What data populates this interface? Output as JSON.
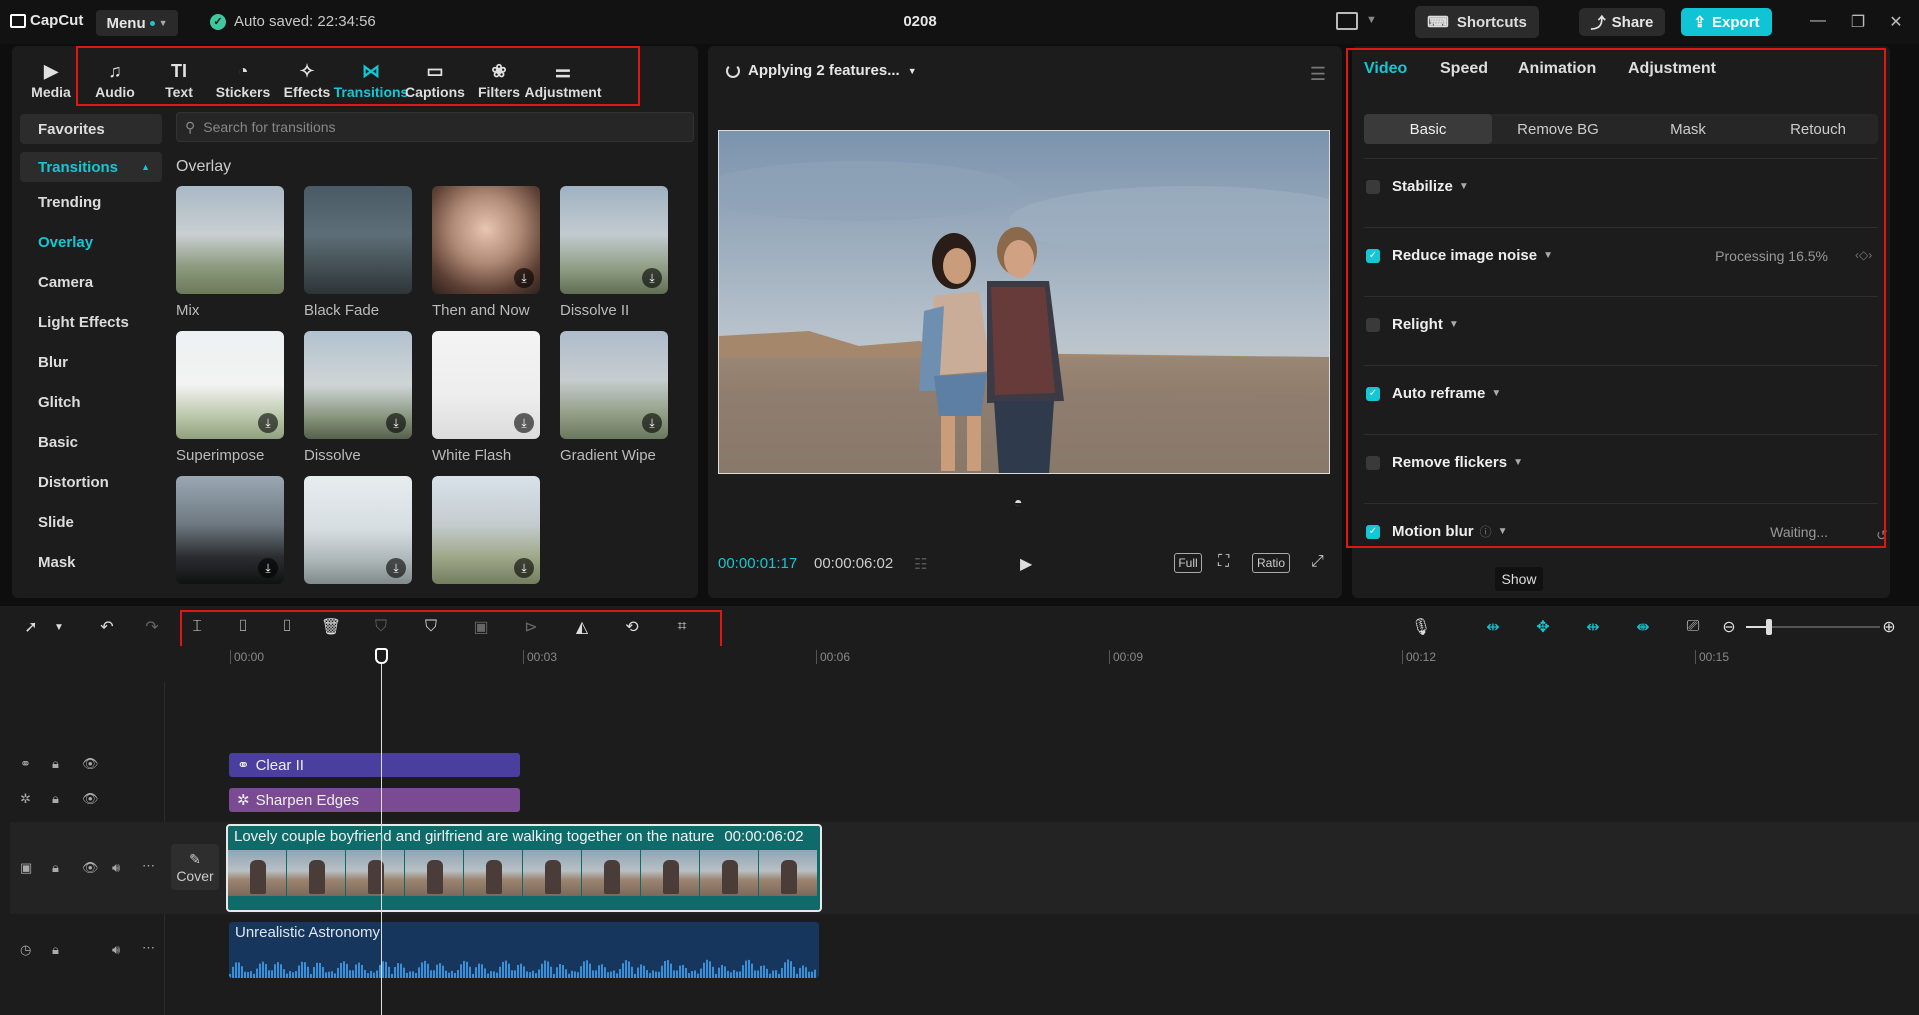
{
  "topbar": {
    "app_name": "CapCut",
    "menu_label": "Menu",
    "autosave": "Auto saved: 22:34:56",
    "project_title": "0208",
    "shortcuts_label": "Shortcuts",
    "share_label": "Share",
    "export_label": "Export"
  },
  "toolbar": [
    {
      "label": "Media",
      "icon": "media-icon",
      "glyph": "▶"
    },
    {
      "label": "Audio",
      "icon": "audio-icon",
      "glyph": "♫"
    },
    {
      "label": "Text",
      "icon": "text-icon",
      "glyph": "TI"
    },
    {
      "label": "Stickers",
      "icon": "stickers-icon",
      "glyph": "◔"
    },
    {
      "label": "Effects",
      "icon": "effects-icon",
      "glyph": "✧"
    },
    {
      "label": "Transitions",
      "icon": "transitions-icon",
      "glyph": "⋈"
    },
    {
      "label": "Captions",
      "icon": "captions-icon",
      "glyph": "▭"
    },
    {
      "label": "Filters",
      "icon": "filters-icon",
      "glyph": "❀"
    },
    {
      "label": "Adjustment",
      "icon": "adjustment-icon",
      "glyph": "⚌"
    }
  ],
  "active_tool": "Transitions",
  "sidebar": {
    "favorites": "Favorites",
    "category": "Transitions",
    "items": [
      "Trending",
      "Overlay",
      "Camera",
      "Light Effects",
      "Blur",
      "Glitch",
      "Basic",
      "Distortion",
      "Slide",
      "Mask"
    ],
    "active": "Overlay"
  },
  "search": {
    "placeholder": "Search for transitions"
  },
  "section_label": "Overlay",
  "thumbnails": [
    {
      "label": "Mix",
      "download": false
    },
    {
      "label": "Black Fade",
      "download": false
    },
    {
      "label": "Then and Now",
      "download": true
    },
    {
      "label": "Dissolve II",
      "download": true
    },
    {
      "label": "Superimpose",
      "download": true
    },
    {
      "label": "Dissolve",
      "download": true
    },
    {
      "label": "White Flash",
      "download": true
    },
    {
      "label": "Gradient Wipe",
      "download": true
    },
    {
      "label": "",
      "download": true
    },
    {
      "label": "",
      "download": true
    },
    {
      "label": "",
      "download": true
    }
  ],
  "preview": {
    "status": "Applying 2 features...",
    "current_time": "00:00:01:17",
    "total_time": "00:00:06:02",
    "full_label": "Full",
    "ratio_label": "Ratio"
  },
  "right_panel": {
    "tabs": [
      "Video",
      "Speed",
      "Animation",
      "Adjustment"
    ],
    "active_tab": "Video",
    "subtabs": [
      "Basic",
      "Remove BG",
      "Mask",
      "Retouch"
    ],
    "active_subtab": "Basic",
    "features": [
      {
        "name": "Stabilize",
        "checked": false,
        "status": ""
      },
      {
        "name": "Reduce image noise",
        "checked": true,
        "status": "Processing 16.5%"
      },
      {
        "name": "Relight",
        "checked": false,
        "status": ""
      },
      {
        "name": "Auto reframe",
        "checked": true,
        "status": ""
      },
      {
        "name": "Remove flickers",
        "checked": false,
        "status": ""
      },
      {
        "name": "Motion blur",
        "checked": true,
        "status": "Waiting..."
      }
    ],
    "tooltip": "Show"
  },
  "timeline": {
    "ruler": [
      "00:00",
      "00:03",
      "00:06",
      "00:09",
      "00:12",
      "00:15"
    ],
    "cover_label": "Cover",
    "clips": {
      "effect1": "Clear II",
      "effect2": "Sharpen Edges",
      "video_title": "Lovely couple boyfriend and girlfriend are walking together on the nature",
      "video_duration": "00:00:06:02",
      "audio_title": "Unrealistic Astronomy"
    }
  },
  "colors": {
    "accent": "#14c7d5",
    "highlight_box": "#e01515",
    "effect_clip": "#4a3f9e",
    "filter_clip": "#7a4a93",
    "video_clip": "#0f6a6a",
    "audio_clip": "#16365e"
  }
}
